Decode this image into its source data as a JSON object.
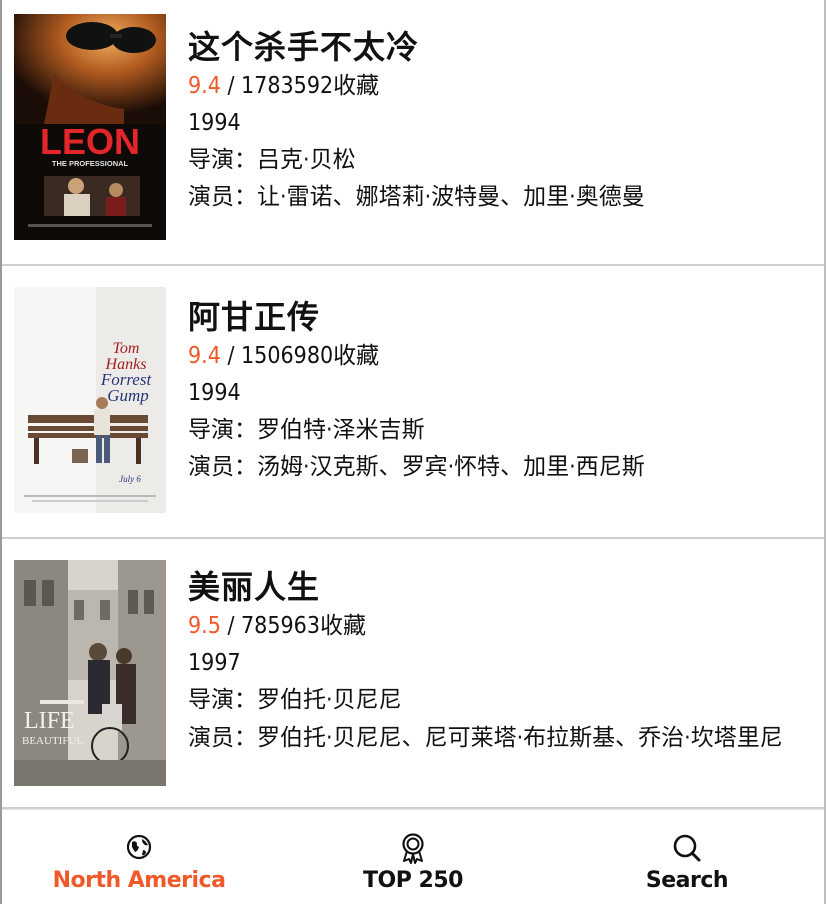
{
  "movies": [
    {
      "title": "这个杀手不太冷",
      "rating": "9.4",
      "stats": " / 1783592收藏",
      "year": "1994",
      "director": "导演：吕克·贝松",
      "cast": "演员：让·雷诺、娜塔莉·波特曼、加里·奥德曼",
      "poster_text": "LEON",
      "poster_subtext": "THE PROFESSIONAL"
    },
    {
      "title": "阿甘正传",
      "rating": "9.4",
      "stats": " / 1506980收藏",
      "year": "1994",
      "director": "导演：罗伯特·泽米吉斯",
      "cast": "演员：汤姆·汉克斯、罗宾·怀特、加里·西尼斯",
      "poster_text_1": "Tom",
      "poster_text_2": "Hanks",
      "poster_text_3": "Forrest",
      "poster_text_4": "Gump",
      "poster_text_5": "July 6"
    },
    {
      "title": "美丽人生",
      "rating": "9.5",
      "stats": " / 785963收藏",
      "year": "1997",
      "director": "导演：罗伯托·贝尼尼",
      "cast": "演员：罗伯托·贝尼尼、尼可莱塔·布拉斯基、乔治·坎塔里尼",
      "poster_text_1": "LIFE",
      "poster_text_2": "BEAUTIFUL"
    }
  ],
  "tabs": [
    {
      "label": "North America",
      "icon": "globe-icon",
      "active": true
    },
    {
      "label": "TOP 250",
      "icon": "award-icon",
      "active": false
    },
    {
      "label": "Search",
      "icon": "search-icon",
      "active": false
    }
  ],
  "colors": {
    "accent": "#f05a2a",
    "divider": "#d0d0d0"
  }
}
